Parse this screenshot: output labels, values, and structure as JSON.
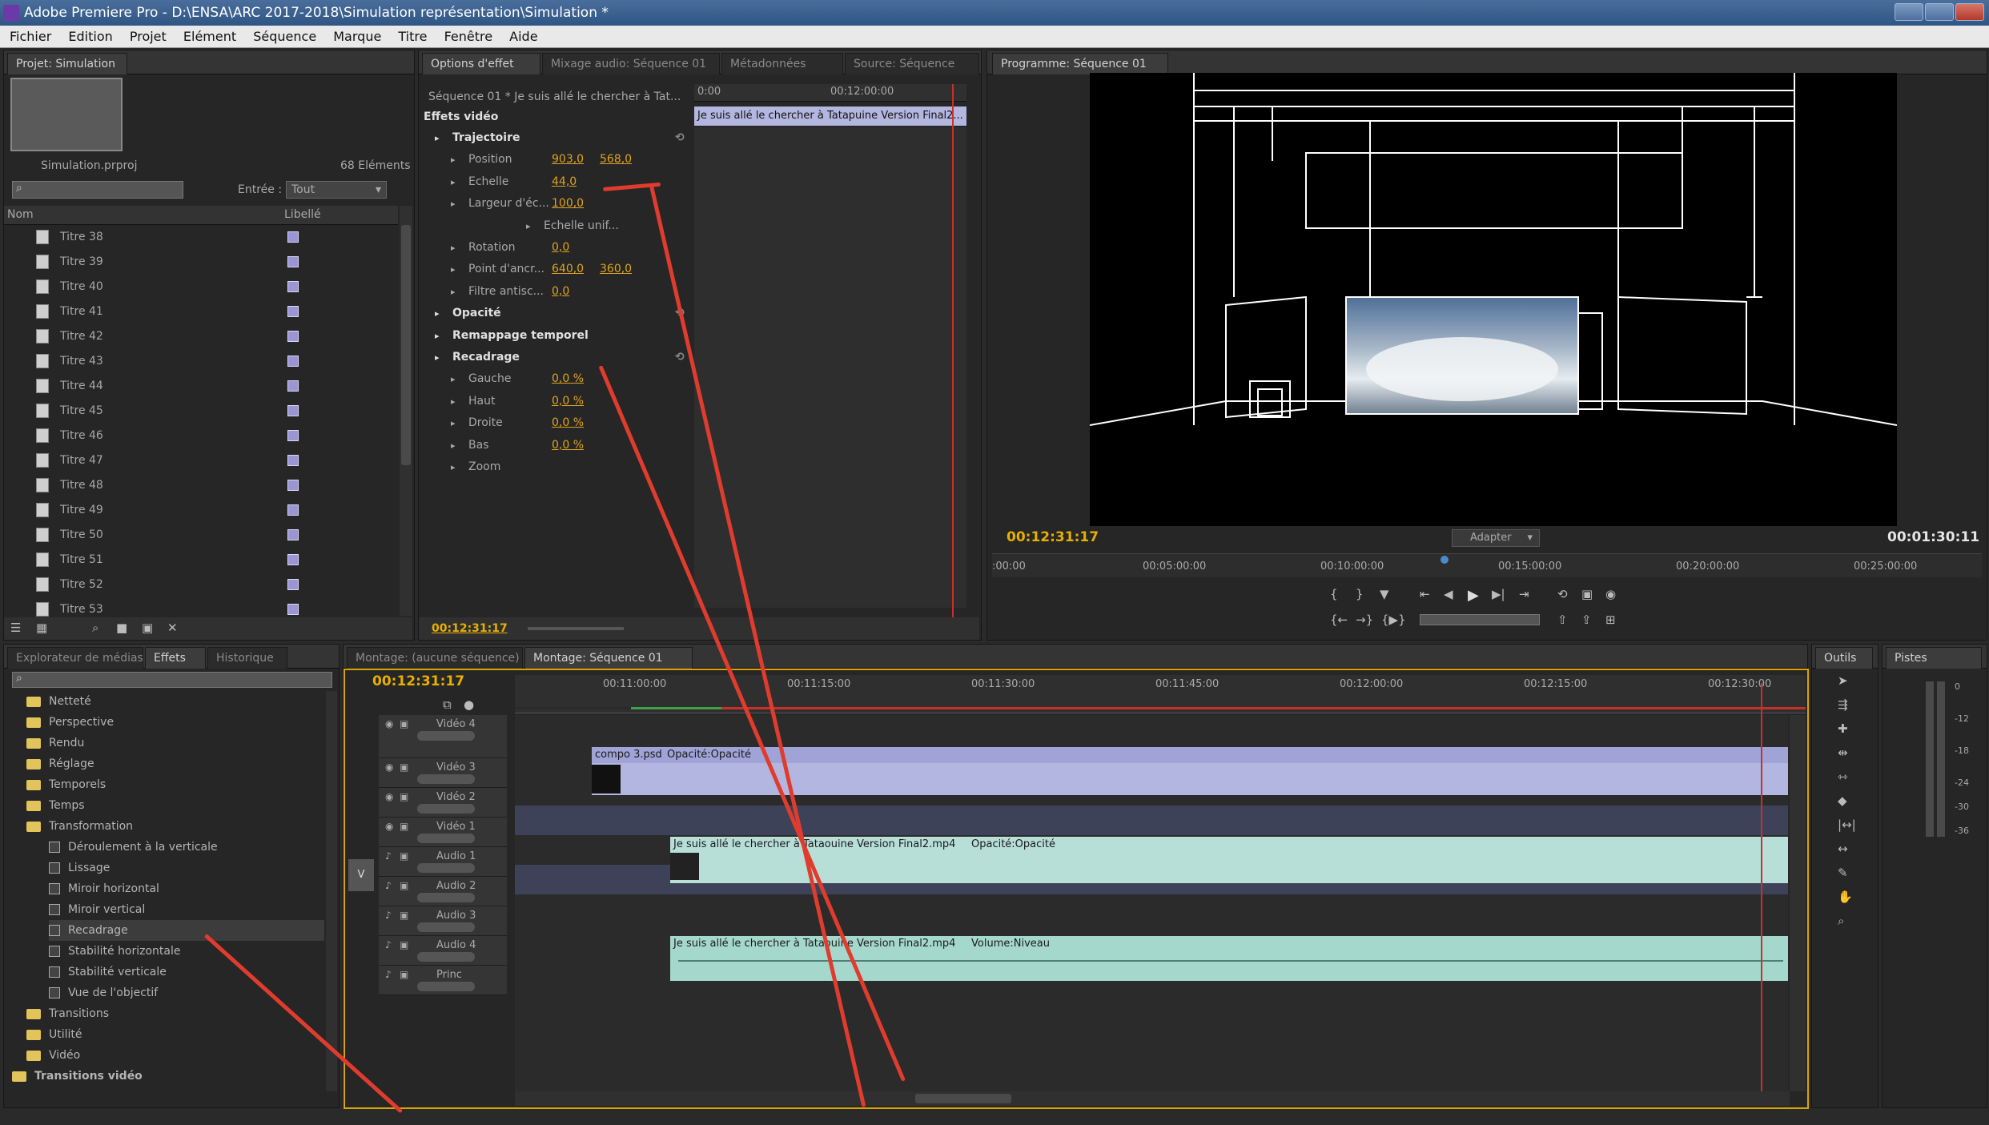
{
  "window": {
    "title": "Adobe Premiere Pro - D:\\ENSA\\ARC 2017-2018\\Simulation représentation\\Simulation *"
  },
  "menu": [
    "Fichier",
    "Edition",
    "Projet",
    "Elément",
    "Séquence",
    "Marque",
    "Titre",
    "Fenêtre",
    "Aide"
  ],
  "project": {
    "tab": "Projet: Simulation",
    "filename": "Simulation.prproj",
    "count": "68 Eléments",
    "input_label": "Entrée :",
    "input_value": "Tout",
    "col_name": "Nom",
    "col_label": "Libellé",
    "items": [
      "Titre 38",
      "Titre 39",
      "Titre 40",
      "Titre 41",
      "Titre 42",
      "Titre 43",
      "Titre 44",
      "Titre 45",
      "Titre 46",
      "Titre 47",
      "Titre 48",
      "Titre 49",
      "Titre 50",
      "Titre 51",
      "Titre 52",
      "Titre 53"
    ]
  },
  "effect_controls": {
    "tabs": [
      "Options d'effet",
      "Mixage audio: Séquence 01",
      "Métadonnées",
      "Source: Séquence"
    ],
    "sequence": "Séquence 01 * Je suis allé le chercher à Tat...",
    "ruler_start": "0:00",
    "ruler_mid": "00:12:00:00",
    "clip_name": "Je suis allé le chercher à Tatapuine Version Final2...",
    "section": "Effets vidéo",
    "rows": [
      {
        "label": "Trajectoire",
        "bold": true,
        "v1": "",
        "v2": ""
      },
      {
        "label": "Position",
        "bold": false,
        "v1": "903,0",
        "v2": "568,0"
      },
      {
        "label": "Echelle",
        "bold": false,
        "v1": "44,0",
        "v2": ""
      },
      {
        "label": "Largeur d'éc...",
        "bold": false,
        "v1": "100,0",
        "v2": ""
      },
      {
        "label": "Echelle unif...",
        "bold": false,
        "v1": "",
        "v2": ""
      },
      {
        "label": "Rotation",
        "bold": false,
        "v1": "0,0",
        "v2": ""
      },
      {
        "label": "Point d'ancr...",
        "bold": false,
        "v1": "640,0",
        "v2": "360,0"
      },
      {
        "label": "Filtre antisc...",
        "bold": false,
        "v1": "0,0",
        "v2": ""
      },
      {
        "label": "Opacité",
        "bold": true,
        "v1": "",
        "v2": ""
      },
      {
        "label": "Remappage temporel",
        "bold": true,
        "v1": "",
        "v2": ""
      },
      {
        "label": "Recadrage",
        "bold": true,
        "v1": "",
        "v2": ""
      },
      {
        "label": "Gauche",
        "bold": false,
        "v1": "0,0 %",
        "v2": ""
      },
      {
        "label": "Haut",
        "bold": false,
        "v1": "0,0 %",
        "v2": ""
      },
      {
        "label": "Droite",
        "bold": false,
        "v1": "0,0 %",
        "v2": ""
      },
      {
        "label": "Bas",
        "bold": false,
        "v1": "0,0 %",
        "v2": ""
      },
      {
        "label": "Zoom",
        "bold": false,
        "v1": "",
        "v2": ""
      }
    ],
    "timecode": "00:12:31:17"
  },
  "program": {
    "tab": "Programme: Séquence 01",
    "timecode_left": "00:12:31:17",
    "timecode_right": "00:01:30:11",
    "fit": "Adapter",
    "ruler": [
      ":00:00",
      "00:05:00:00",
      "00:10:00:00",
      "00:15:00:00",
      "00:20:00:00",
      "00:25:00:00"
    ]
  },
  "effects": {
    "tabs": [
      "Explorateur de médias",
      "Effets",
      "Historique"
    ],
    "items": [
      {
        "label": "Netteté",
        "type": "folder",
        "indent": 1
      },
      {
        "label": "Perspective",
        "type": "folder",
        "indent": 1
      },
      {
        "label": "Rendu",
        "type": "folder",
        "indent": 1
      },
      {
        "label": "Réglage",
        "type": "folder",
        "indent": 1
      },
      {
        "label": "Temporels",
        "type": "folder",
        "indent": 1
      },
      {
        "label": "Temps",
        "type": "folder",
        "indent": 1
      },
      {
        "label": "Transformation",
        "type": "folder",
        "indent": 1
      },
      {
        "label": "Déroulement à la verticale",
        "type": "fx",
        "indent": 2
      },
      {
        "label": "Lissage",
        "type": "fx",
        "indent": 2
      },
      {
        "label": "Miroir horizontal",
        "type": "fx",
        "indent": 2
      },
      {
        "label": "Miroir vertical",
        "type": "fx",
        "indent": 2
      },
      {
        "label": "Recadrage",
        "type": "fx",
        "indent": 2
      },
      {
        "label": "Stabilité horizontale",
        "type": "fx",
        "indent": 2
      },
      {
        "label": "Stabilité verticale",
        "type": "fx",
        "indent": 2
      },
      {
        "label": "Vue de l'objectif",
        "type": "fx",
        "indent": 2
      },
      {
        "label": "Transitions",
        "type": "folder",
        "indent": 1
      },
      {
        "label": "Utilité",
        "type": "folder",
        "indent": 1
      },
      {
        "label": "Vidéo",
        "type": "folder",
        "indent": 1
      },
      {
        "label": "Transitions vidéo",
        "type": "folder",
        "indent": 0
      }
    ]
  },
  "timeline": {
    "tabs": [
      "Montage: (aucune séquence)",
      "Montage: Séquence 01"
    ],
    "timecode": "00:12:31:17",
    "ruler": [
      "00:11:00:00",
      "00:11:15:00",
      "00:11:30:00",
      "00:11:45:00",
      "00:12:00:00",
      "00:12:15:00",
      "00:12:30:00"
    ],
    "tracks": [
      "Vidéo 4",
      "Vidéo 3",
      "Vidéo 2",
      "Vidéo 1",
      "Audio 1",
      "Audio 2",
      "Audio 3",
      "Audio 4",
      "Princ"
    ],
    "v_marker": "V",
    "clips": {
      "psd": "compo 3.psd",
      "psd_fx": "Opacité:Opacité",
      "video": "Je suis allé le chercher à Tataouine Version Final2.mp4",
      "video_fx": "Opacité:Opacité",
      "audio": "Je suis allé le chercher à Tataouine Version Final2.mp4",
      "audio_fx": "Volume:Niveau"
    }
  },
  "tools": {
    "tab": "Outils"
  },
  "meter": {
    "tab": "Pistes",
    "scale": [
      "0",
      "-12",
      "-18",
      "-24",
      "-30",
      "-36"
    ]
  },
  "colors": {
    "accent": "#e6b000",
    "annotation": "#e03c2e",
    "clip_video": "#9fa8d8",
    "clip_audio": "#8fd0c4"
  }
}
